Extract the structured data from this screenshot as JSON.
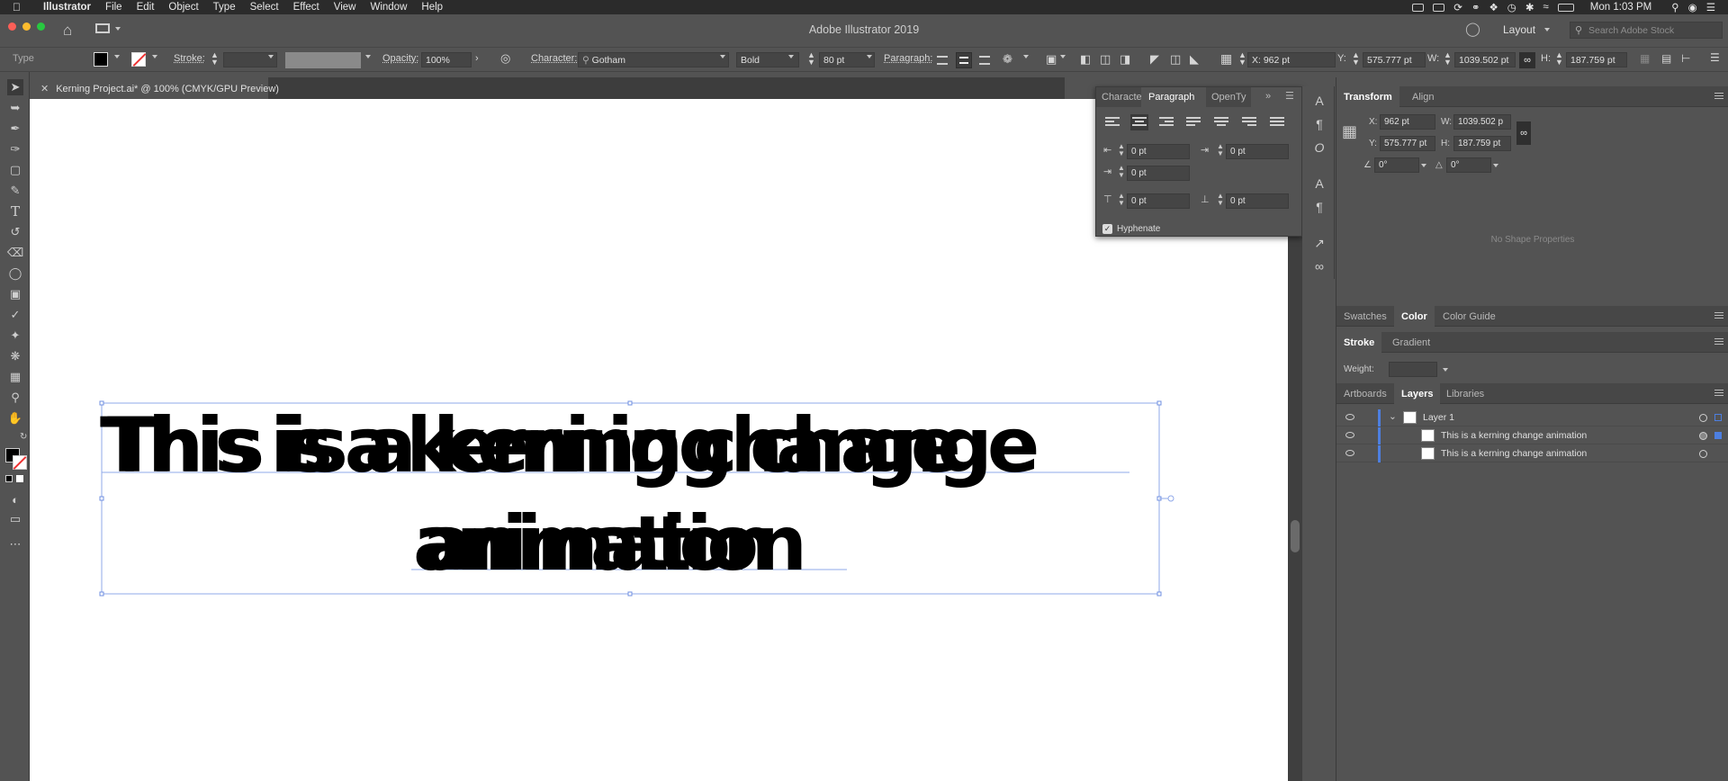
{
  "menubar": {
    "items": [
      "Illustrator",
      "File",
      "Edit",
      "Object",
      "Type",
      "Select",
      "Effect",
      "View",
      "Window",
      "Help"
    ],
    "clock": "Mon 1:03 PM"
  },
  "titlebar": {
    "title": "Adobe Illustrator 2019",
    "workspace": "Layout",
    "search_placeholder": "Search Adobe Stock"
  },
  "controlbar": {
    "mode": "Type",
    "stroke_label": "Stroke:",
    "opacity_label": "Opacity:",
    "opacity_value": "100%",
    "character_label": "Character:",
    "font_family": "Gotham",
    "font_style": "Bold",
    "font_size": "80 pt",
    "paragraph_label": "Paragraph:",
    "x_label": "X:",
    "x_value": "962 pt",
    "y_label": "Y:",
    "y_value": "575.777 pt",
    "w_label": "W:",
    "w_value": "1039.502 pt",
    "h_label": "H:",
    "h_value": "187.759 pt"
  },
  "document": {
    "tab_title": "Kerning Project.ai* @ 100% (CMYK/GPU Preview)",
    "line1": "This is a kerning change",
    "line1_ghost": "This is a kerning change",
    "line2": "animation",
    "line2_ghost": "animation"
  },
  "paragraph_panel": {
    "tabs": [
      "Characte",
      "Paragraph",
      "OpenTy"
    ],
    "left_indent": "0 pt",
    "right_indent": "0 pt",
    "first_line_indent": "0 pt",
    "space_before": "0 pt",
    "space_after": "0 pt",
    "hyphenate_label": "Hyphenate",
    "hyphenate_checked": true
  },
  "transform_panel": {
    "tabs": [
      "Transform",
      "Align"
    ],
    "x_label": "X:",
    "x_value": "962 pt",
    "y_label": "Y:",
    "y_value": "575.777 pt",
    "w_label": "W:",
    "w_value": "1039.502 p",
    "h_label": "H:",
    "h_value": "187.759 pt",
    "angle_value": "0°",
    "shear_value": "0°",
    "empty_message": "No Shape Properties"
  },
  "color_panel": {
    "tabs": [
      "Swatches",
      "Color",
      "Color Guide"
    ]
  },
  "stroke_panel": {
    "tabs": [
      "Stroke",
      "Gradient"
    ],
    "weight_label": "Weight:"
  },
  "layers_panel": {
    "tabs": [
      "Artboards",
      "Layers",
      "Libraries"
    ],
    "layer_name": "Layer 1",
    "items": [
      "This is a kerning change animation",
      "This is a kerning change animation"
    ]
  },
  "colors": {
    "accent": "#4d7fe0",
    "selection": "#8fa8e8",
    "ui_bg": "#535353"
  }
}
